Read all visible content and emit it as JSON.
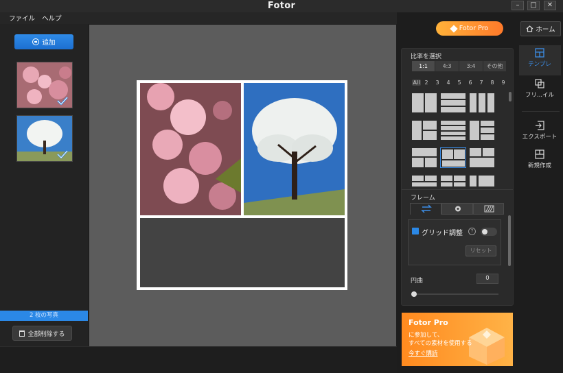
{
  "app": {
    "title": "Fotor"
  },
  "window_controls": {
    "minimize": "–",
    "maximize": "□",
    "close": "✕"
  },
  "menu": {
    "file": "ファイル",
    "help": "ヘルプ"
  },
  "left": {
    "add_label": "追加",
    "photo_count": "2 枚の写真",
    "delete_all": "全部削除する"
  },
  "top_right": {
    "pro_label": "Fotor Pro",
    "home_label": "ホーム"
  },
  "ratio": {
    "title": "比率を選択",
    "options": [
      "1:1",
      "4:3",
      "3:4",
      "その他"
    ],
    "selected": "1:1"
  },
  "counts": [
    "All",
    "2",
    "3",
    "4",
    "5",
    "6",
    "7",
    "8",
    "9"
  ],
  "frame": {
    "title": "フレーム",
    "grid_adjust": "グリッド調整",
    "help": "?",
    "reset": "リセット",
    "curve_label": "円曲",
    "curve_value": "0"
  },
  "sidenav": {
    "template": "テンプレ",
    "freestyle": "フリ...イル",
    "export": "エクスポート",
    "new": "新規作成"
  },
  "promo": {
    "title": "Fotor Pro",
    "line1": "に参加して、",
    "line2": "すべての素材を使用する",
    "cta": "今すぐ購読"
  },
  "colors": {
    "accent": "#2b88e6",
    "pro_gradient_start": "#ffb23a",
    "pro_gradient_end": "#ff7a2a"
  }
}
